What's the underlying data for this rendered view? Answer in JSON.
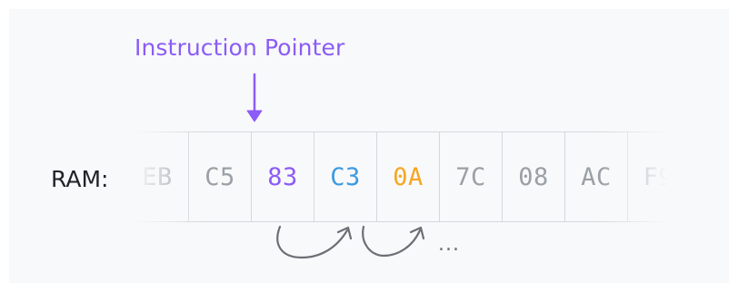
{
  "diagram": {
    "pointer_label": "Instruction Pointer",
    "ram_label": "RAM:",
    "continuation": "...",
    "cells": [
      {
        "value": "EB",
        "color": "#9aa0a6"
      },
      {
        "value": "C5",
        "color": "#9aa0a6"
      },
      {
        "value": "83",
        "color": "#8b5cf6"
      },
      {
        "value": "C3",
        "color": "#3b9ae1"
      },
      {
        "value": "0A",
        "color": "#f5a623"
      },
      {
        "value": "7C",
        "color": "#9aa0a6"
      },
      {
        "value": "08",
        "color": "#9aa0a6"
      },
      {
        "value": "AC",
        "color": "#9aa0a6"
      },
      {
        "value": "F9",
        "color": "#9aa0a6"
      }
    ],
    "pointer_index": 2,
    "colors": {
      "pointer": "#8b5cf6",
      "arrow_stroke": "#6b7075",
      "cell_border": "#d5d8dc",
      "background": "#f8f9fa"
    }
  }
}
